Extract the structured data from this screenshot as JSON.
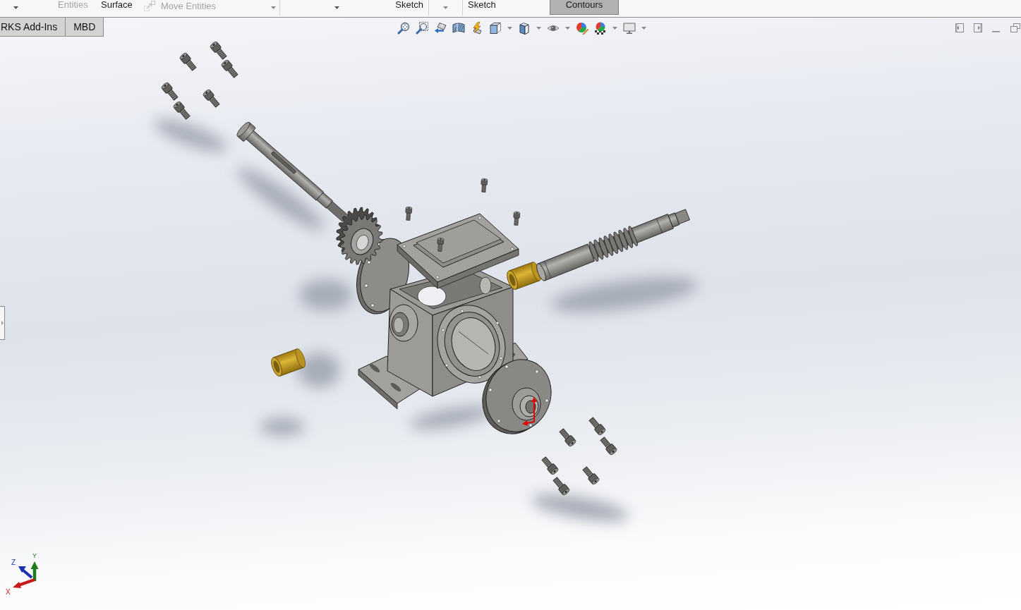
{
  "ribbon": {
    "items": [
      {
        "label": "Entities",
        "disabled": true,
        "pressed": false
      },
      {
        "label": "Surface",
        "disabled": false,
        "pressed": false
      },
      {
        "label": "Move Entities",
        "disabled": true,
        "pressed": false
      },
      {
        "label": "Sketch",
        "disabled": false,
        "pressed": false
      },
      {
        "label": "Sketch",
        "disabled": false,
        "pressed": false
      },
      {
        "label": "Contours",
        "disabled": false,
        "pressed": true
      }
    ]
  },
  "tabs": [
    {
      "label": "RKS Add-Ins",
      "selected": false
    },
    {
      "label": "MBD",
      "selected": false
    }
  ],
  "triad": {
    "x_label": "X",
    "y_label": "Y",
    "z_label": "Z"
  }
}
